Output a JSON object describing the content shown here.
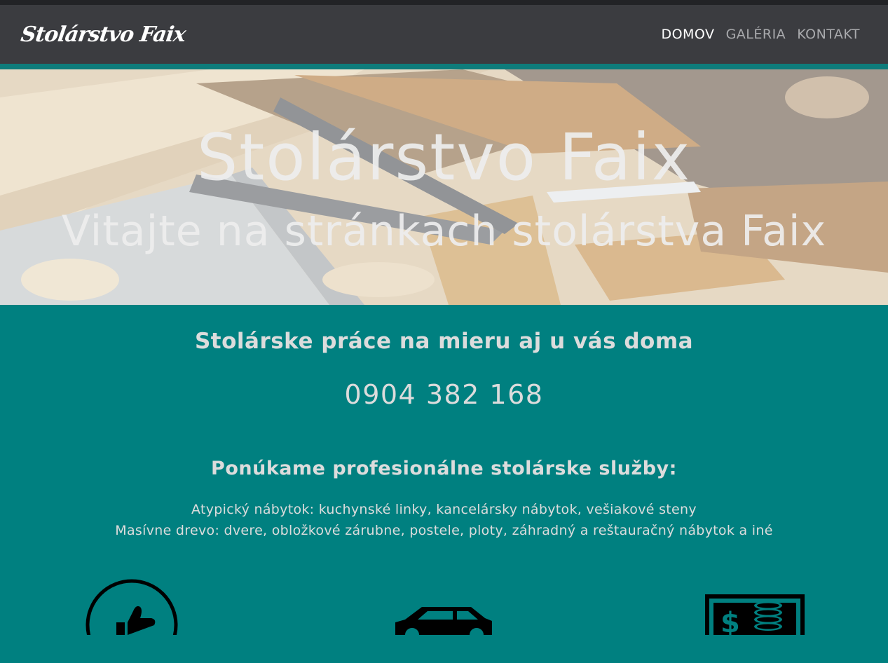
{
  "header": {
    "brand": "Stolárstvo Faix",
    "nav": [
      {
        "label": "DOMOV",
        "active": true
      },
      {
        "label": "GALÉRIA",
        "active": false
      },
      {
        "label": "KONTAKT",
        "active": false
      }
    ]
  },
  "hero": {
    "title": "Stolárstvo Faix",
    "subtitle": "Vitajte na stránkach stolárstva Faix"
  },
  "main": {
    "tagline": "Stolárske práce na mieru aj u vás doma",
    "phone": "0904 382 168",
    "offer_title": "Ponúkame profesionálne stolárske služby:",
    "offer_lines": [
      "Atypický nábytok: kuchynské linky, kancelársky nábytok, vešiakové steny",
      "Masívne drevo: dvere, obložkové zárubne, postele, ploty, záhradný a reštauračný nábytok a iné"
    ]
  },
  "features": [
    {
      "icon": "thumbs-up-icon"
    },
    {
      "icon": "car-icon"
    },
    {
      "icon": "money-icon"
    }
  ],
  "colors": {
    "teal": "#008080",
    "navbar": "#3b3c40",
    "text_light": "#dcdcdc"
  }
}
